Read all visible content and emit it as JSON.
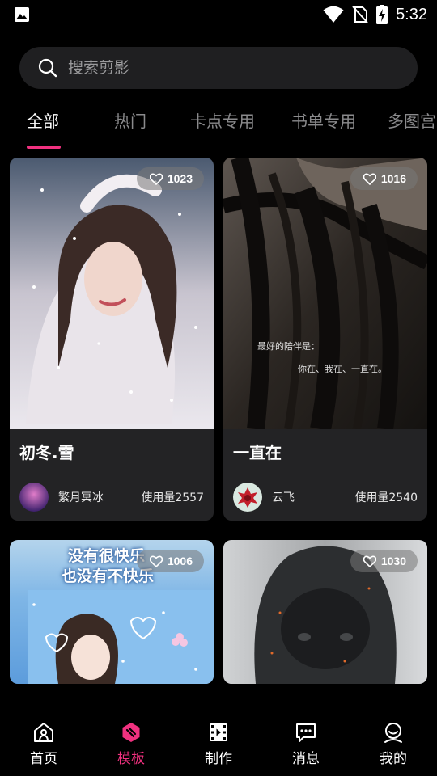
{
  "status_bar": {
    "time": "5:32"
  },
  "search": {
    "placeholder": "搜索剪影"
  },
  "tabs": [
    {
      "label": "全部"
    },
    {
      "label": "热门"
    },
    {
      "label": "卡点专用"
    },
    {
      "label": "书单专用"
    },
    {
      "label": "多图宫"
    }
  ],
  "cards": [
    {
      "likes": "1023",
      "title": "初冬.雪",
      "author": "繁月冥冰",
      "usage": "使用量2557",
      "overlay_lines": []
    },
    {
      "likes": "1016",
      "title": "一直在",
      "author": "云飞",
      "usage": "使用量2540",
      "overlay_lines": [
        "最好的陪伴是：",
        "你在、我在、一直在。"
      ]
    },
    {
      "likes": "1006",
      "title": "",
      "author": "",
      "usage": "",
      "overlay_lines": [
        "没有很快乐",
        "也没有不快乐"
      ]
    },
    {
      "likes": "1030",
      "title": "",
      "author": "",
      "usage": "",
      "overlay_lines": []
    }
  ],
  "bottom_nav": [
    {
      "label": "首页",
      "icon": "home-icon"
    },
    {
      "label": "模板",
      "icon": "template-icon"
    },
    {
      "label": "制作",
      "icon": "video-icon"
    },
    {
      "label": "消息",
      "icon": "message-icon"
    },
    {
      "label": "我的",
      "icon": "profile-icon"
    }
  ],
  "colors": {
    "accent": "#f0317f",
    "background": "#000000",
    "card": "#232325",
    "search_bg": "#1f1f21"
  }
}
